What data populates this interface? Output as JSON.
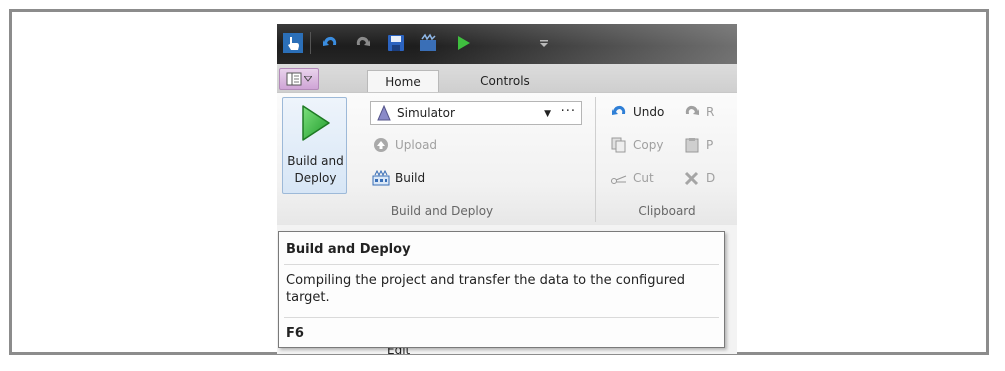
{
  "tabs": [
    {
      "label": "Home",
      "active": true
    },
    {
      "label": "Controls",
      "active": false
    }
  ],
  "quick_access_icons": [
    "touch-icon",
    "undo-icon",
    "redo-icon",
    "save-icon",
    "build-icon",
    "run-icon",
    "customize-dropdown-icon"
  ],
  "build_deploy_group": {
    "big_button_label": "Build and Deploy",
    "target_combo_value": "Simulator",
    "target_combo_more": "···",
    "upload_label": "Upload",
    "build_label": "Build",
    "group_label": "Build and Deploy"
  },
  "clipboard_group": {
    "undo_label": "Undo",
    "redo_label": "R",
    "copy_label": "Copy",
    "paste_label": "P",
    "cut_label": "Cut",
    "delete_label": "D",
    "group_label": "Clipboard"
  },
  "tooltip": {
    "title": "Build and Deploy",
    "description": "Compiling the project and transfer the data to the configured target.",
    "shortcut": "F6"
  },
  "background_partial_text": "Edit",
  "colors": {
    "accent_green": "#3fbf3f",
    "undo_blue": "#2f7fd6",
    "qat_dark": "#1d1d1d",
    "app_menu_pink": "#cfa4d6"
  }
}
